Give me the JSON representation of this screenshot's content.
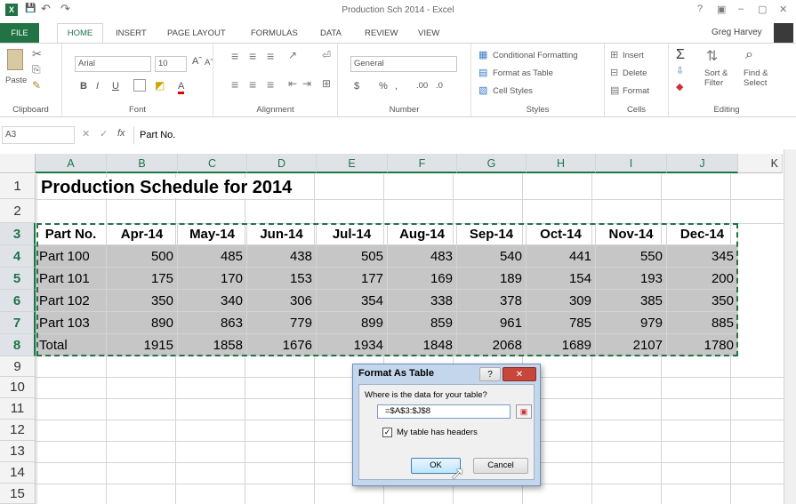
{
  "window": {
    "title": "Production Sch 2014 - Excel",
    "app_icon": "X",
    "help": "?",
    "minimize": "–",
    "restore": "▢",
    "close": "✕"
  },
  "qat": {
    "save": "💾",
    "undo": "↶",
    "redo": "↷"
  },
  "tabs": [
    "FILE",
    "HOME",
    "INSERT",
    "PAGE LAYOUT",
    "FORMULAS",
    "DATA",
    "REVIEW",
    "VIEW"
  ],
  "user": "Greg Harvey",
  "ribbon": {
    "clipboard": {
      "label": "Clipboard",
      "paste": "Paste"
    },
    "font": {
      "label": "Font",
      "name": "Arial",
      "size": "10",
      "bold": "B",
      "italic": "I",
      "underline": "U",
      "grow": "Aˆ",
      "shrink": "Aˇ",
      "color": "A"
    },
    "alignment": {
      "label": "Alignment"
    },
    "number": {
      "label": "Number",
      "format": "General",
      "currency": "$",
      "percent": "%",
      "comma": ",",
      "inc_dec": ".00",
      "dec_dec": ".0"
    },
    "styles": {
      "label": "Styles",
      "conditional": "Conditional Formatting",
      "format_table": "Format as Table",
      "cell_styles": "Cell Styles"
    },
    "cells": {
      "label": "Cells",
      "insert": "Insert",
      "delete": "Delete",
      "format": "Format"
    },
    "editing": {
      "label": "Editing",
      "sum": "Σ",
      "sort": "Sort & Filter",
      "find": "Find & Select"
    }
  },
  "formula_bar": {
    "name_box": "A3",
    "fx": "fx",
    "content": "Part No."
  },
  "columns": [
    "A",
    "B",
    "C",
    "D",
    "E",
    "F",
    "G",
    "H",
    "I",
    "J",
    "K"
  ],
  "rows": [
    "1",
    "2",
    "3",
    "4",
    "5",
    "6",
    "7",
    "8",
    "9",
    "10",
    "11",
    "12",
    "13",
    "14",
    "15"
  ],
  "sheet": {
    "title": "Production Schedule for 2014",
    "headers": [
      "Part No.",
      "Apr-14",
      "May-14",
      "Jun-14",
      "Jul-14",
      "Aug-14",
      "Sep-14",
      "Oct-14",
      "Nov-14",
      "Dec-14"
    ],
    "data": [
      [
        "Part 100",
        "500",
        "485",
        "438",
        "505",
        "483",
        "540",
        "441",
        "550",
        "345"
      ],
      [
        "Part 101",
        "175",
        "170",
        "153",
        "177",
        "169",
        "189",
        "154",
        "193",
        "200"
      ],
      [
        "Part 102",
        "350",
        "340",
        "306",
        "354",
        "338",
        "378",
        "309",
        "385",
        "350"
      ],
      [
        "Part 103",
        "890",
        "863",
        "779",
        "899",
        "859",
        "961",
        "785",
        "979",
        "885"
      ],
      [
        "Total",
        "1915",
        "1858",
        "1676",
        "1934",
        "1848",
        "2068",
        "1689",
        "2107",
        "1780"
      ]
    ]
  },
  "dialog": {
    "title": "Format As Table",
    "help": "?",
    "close": "✕",
    "question": "Where is the data for your table?",
    "range": "=$A$3:$J$8",
    "headers_label": "My table has headers",
    "ok": "OK",
    "cancel": "Cancel"
  },
  "colors": {
    "excel_green": "#217346",
    "shade": "#c6c6c6",
    "dialog_frame": "#c4d6ec"
  }
}
